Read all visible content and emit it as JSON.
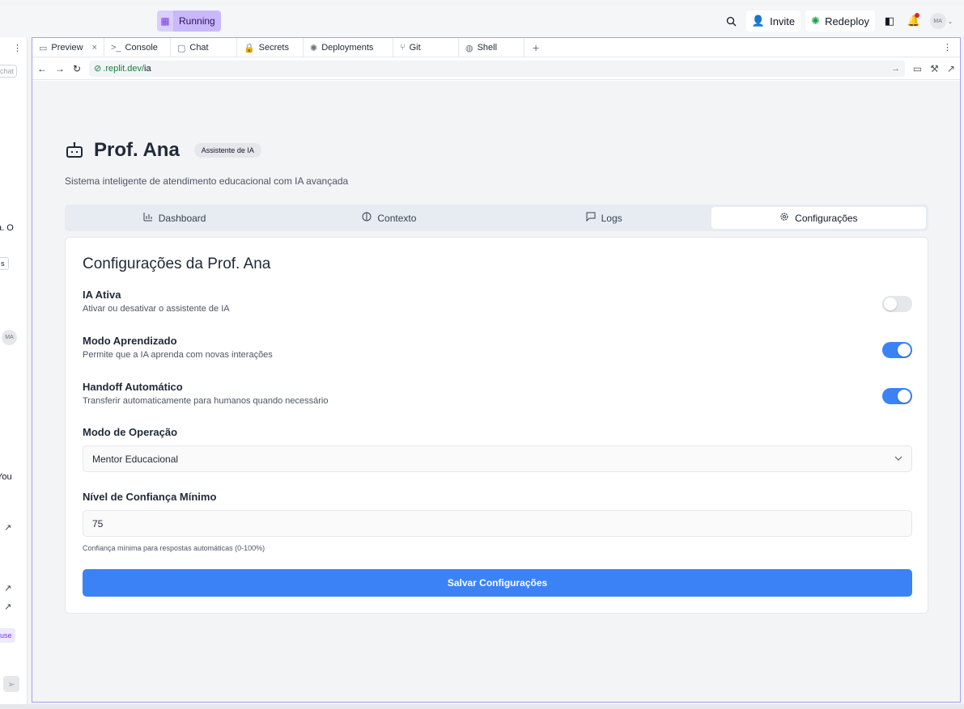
{
  "topbar": {
    "status_label": "Running",
    "invite_label": "Invite",
    "redeploy_label": "Redeploy",
    "avatar_initials": "MA"
  },
  "left_column": {
    "chat_button": "chat",
    "text_o": "a. O",
    "text_s": "s",
    "avatar": "MA",
    "text_you": "You",
    "text_use": "use"
  },
  "tabs": [
    {
      "label": "Preview",
      "icon": "monitor-icon"
    },
    {
      "label": "Console",
      "icon": "terminal-icon"
    },
    {
      "label": "Chat",
      "icon": "chat-icon"
    },
    {
      "label": "Secrets",
      "icon": "lock-icon"
    },
    {
      "label": "Deployments",
      "icon": "deploy-icon"
    },
    {
      "label": "Git",
      "icon": "git-icon"
    },
    {
      "label": "Shell",
      "icon": "shell-icon"
    }
  ],
  "urlbar": {
    "host": ".replit.dev/",
    "path": "ia"
  },
  "page": {
    "title": "Prof. Ana",
    "badge": "Assistente de IA",
    "subtitle": "Sistema inteligente de atendimento educacional com IA avançada"
  },
  "nav_tabs": [
    {
      "label": "Dashboard",
      "icon": "chart-icon",
      "active": false
    },
    {
      "label": "Contexto",
      "icon": "brain-icon",
      "active": false
    },
    {
      "label": "Logs",
      "icon": "message-icon",
      "active": false
    },
    {
      "label": "Configurações",
      "icon": "gear-icon",
      "active": true
    }
  ],
  "settings": {
    "title": "Configurações da Prof. Ana",
    "ia_ativa": {
      "label": "IA Ativa",
      "description": "Ativar ou desativar o assistente de IA",
      "enabled": false
    },
    "modo_aprendizado": {
      "label": "Modo Aprendizado",
      "description": "Permite que a IA aprenda com novas interações",
      "enabled": true
    },
    "handoff": {
      "label": "Handoff Automático",
      "description": "Transferir automaticamente para humanos quando necessário",
      "enabled": true
    },
    "modo_operacao": {
      "label": "Modo de Operação",
      "value": "Mentor Educacional"
    },
    "confianca": {
      "label": "Nível de Confiança Mínimo",
      "value": "75",
      "hint": "Confiança mínima para respostas automáticas (0-100%)"
    },
    "save_label": "Salvar Configurações"
  },
  "colors": {
    "accent": "#3b82f6",
    "running_bg": "#c9b8fb",
    "pane_border": "#a5a0f3"
  }
}
